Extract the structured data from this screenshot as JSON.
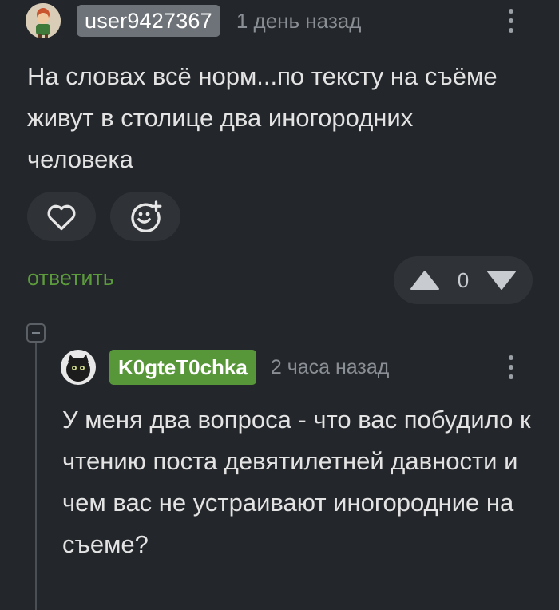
{
  "comments": [
    {
      "username": "user9427367",
      "timestamp": "1 день назад",
      "text": "На словах всё норм...по тексту на съёме живут в столице два иногородних человека",
      "reply_label": "ответить",
      "rating": "0"
    },
    {
      "username": "K0gteT0chka",
      "timestamp": "2 часа назад",
      "text": "У меня два вопроса - что вас побудило к чтению поста девятилетней давности и чем вас не устраивают иногородние на съеме?"
    }
  ],
  "icons": {
    "like": "heart-icon",
    "react": "emoji-add-icon",
    "upvote": "arrow-up-icon",
    "downvote": "arrow-down-icon",
    "menu": "more-vertical-icon",
    "collapse": "collapse-thread-icon"
  },
  "colors": {
    "background": "#23262a",
    "badge_gray": "#6e7379",
    "badge_green": "#57973a",
    "reply_green": "#5c9b3c"
  }
}
